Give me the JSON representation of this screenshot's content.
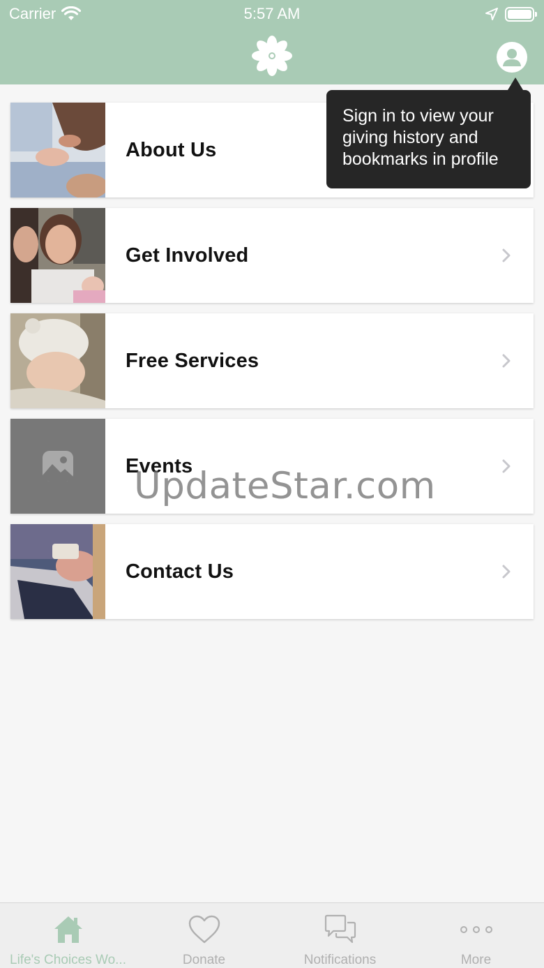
{
  "status_bar": {
    "carrier": "Carrier",
    "time": "5:57 AM"
  },
  "header": {
    "logo_icon": "flower-logo-icon",
    "profile_icon": "user-profile-icon",
    "bar_color": "#a9cbb5"
  },
  "tooltip": {
    "text": "Sign in to view your giving history and bookmarks in profile"
  },
  "menu": {
    "items": [
      {
        "label": "About Us",
        "thumbnail": "baby-hand-photo"
      },
      {
        "label": "Get Involved",
        "thumbnail": "family-with-newborn-photo"
      },
      {
        "label": "Free Services",
        "thumbnail": "sleeping-baby-photo"
      },
      {
        "label": "Events",
        "thumbnail": "image-placeholder-icon"
      },
      {
        "label": "Contact Us",
        "thumbnail": "phone-and-laptop-photo"
      }
    ]
  },
  "watermark": "UpdateStar.com",
  "tabbar": {
    "tabs": [
      {
        "label": "Life's Choices Wo...",
        "icon": "home-icon",
        "active": true
      },
      {
        "label": "Donate",
        "icon": "heart-icon",
        "active": false
      },
      {
        "label": "Notifications",
        "icon": "chat-bubbles-icon",
        "active": false
      },
      {
        "label": "More",
        "icon": "more-dots-icon",
        "active": false
      }
    ],
    "active_color": "#a9cbb5",
    "inactive_color": "#b0b0b0"
  }
}
